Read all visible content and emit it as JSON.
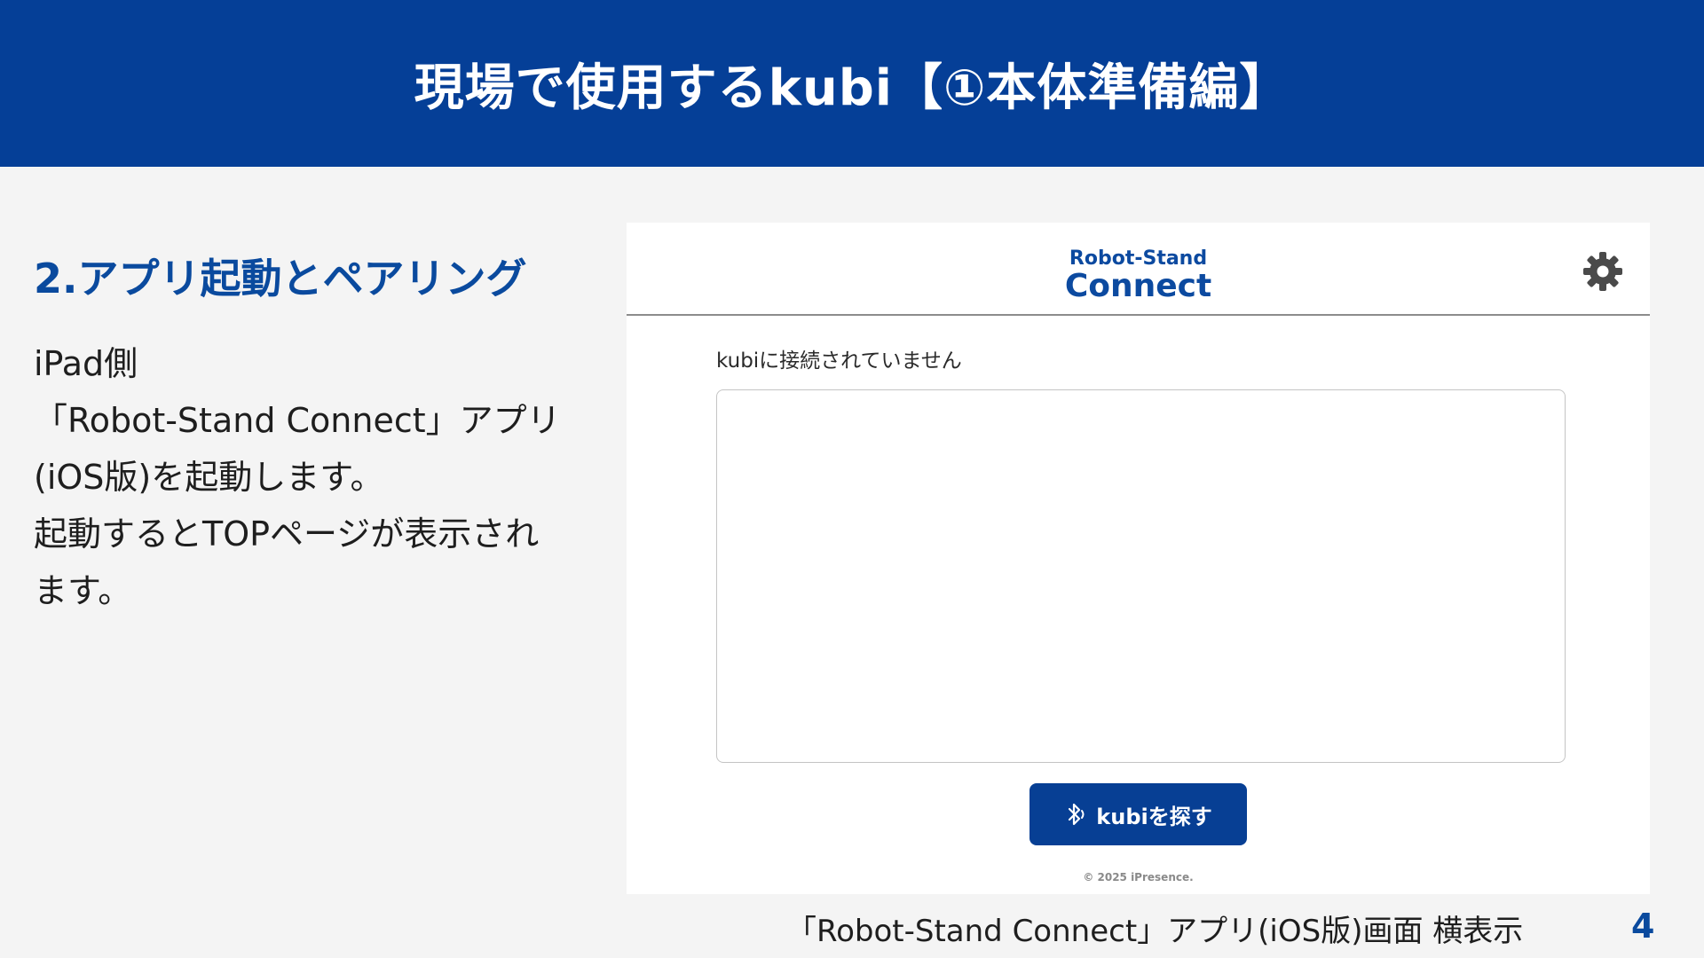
{
  "slide": {
    "title": "現場で使用するkubi【①本体準備編】",
    "section_title": "2.アプリ起動とペアリング",
    "body_lines": [
      "iPad側",
      "「Robot-Stand Connect」アプリ",
      "(iOS版)を起動します。",
      "起動するとTOPページが表示され",
      "ます。"
    ],
    "caption": "「Robot-Stand Connect」アプリ(iOS版)画面 横表示",
    "page_number": "4"
  },
  "app": {
    "logo_top": "Robot-Stand",
    "logo_bottom": "Connect",
    "settings_icon": "gear-icon",
    "status_text": "kubiに接続されていません",
    "find_button_icon": "bluetooth-icon",
    "find_button_label": "kubiを探す",
    "copyright": "© 2025 iPresence."
  },
  "colors": {
    "brand_blue": "#053f97",
    "heading_blue": "#0a4a9e",
    "background": "#f4f4f4"
  }
}
